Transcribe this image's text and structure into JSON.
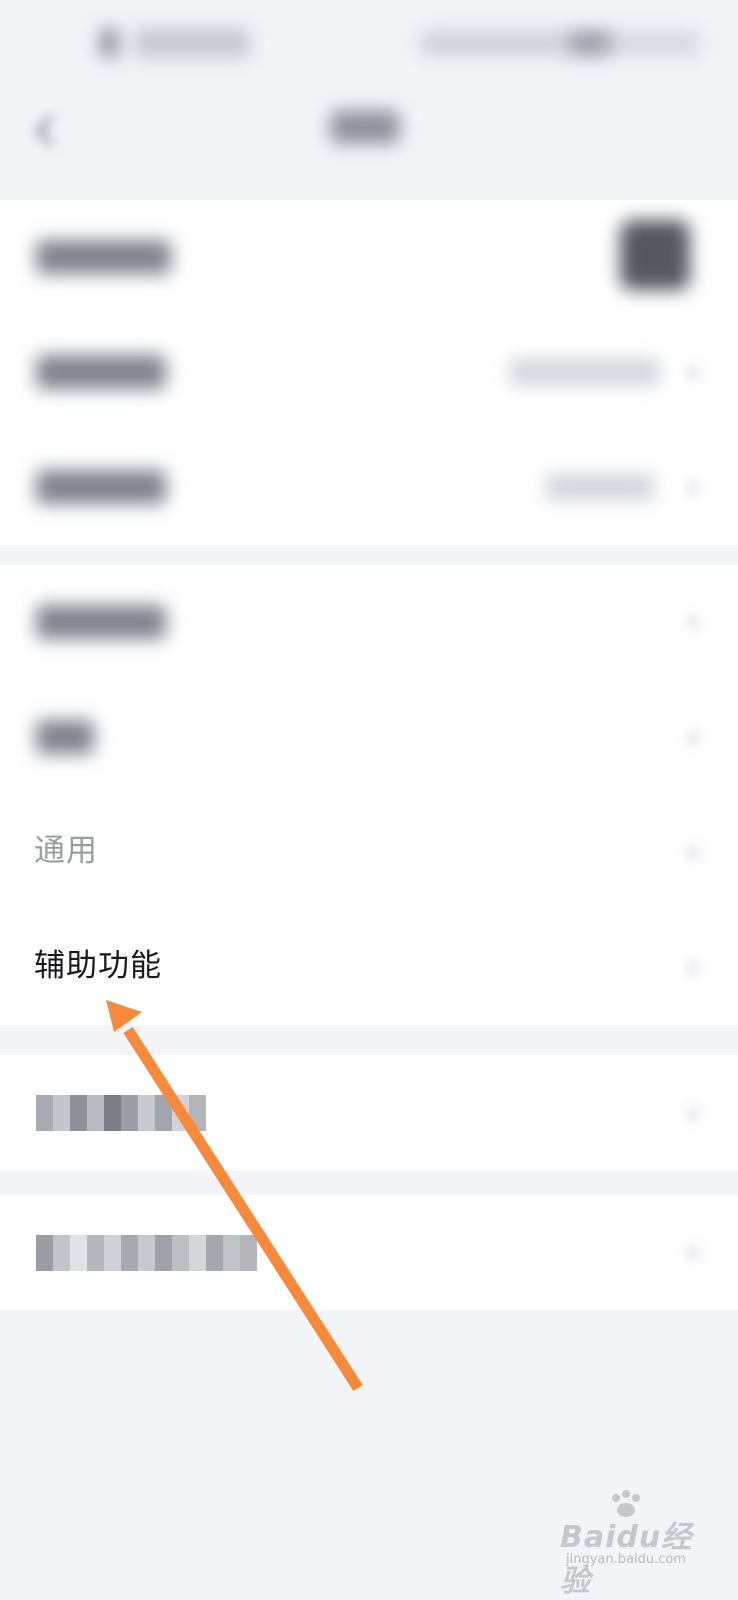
{
  "settings_list": {
    "general_label": "通用",
    "accessibility_label": "辅助功能"
  },
  "watermark": {
    "logo_text": "Baidu经验",
    "site_text": "jingyan.baidu.com"
  },
  "annotation": {
    "arrow_color": "#f7893b"
  },
  "colors": {
    "background": "#f3f4f8",
    "card": "#ffffff"
  }
}
